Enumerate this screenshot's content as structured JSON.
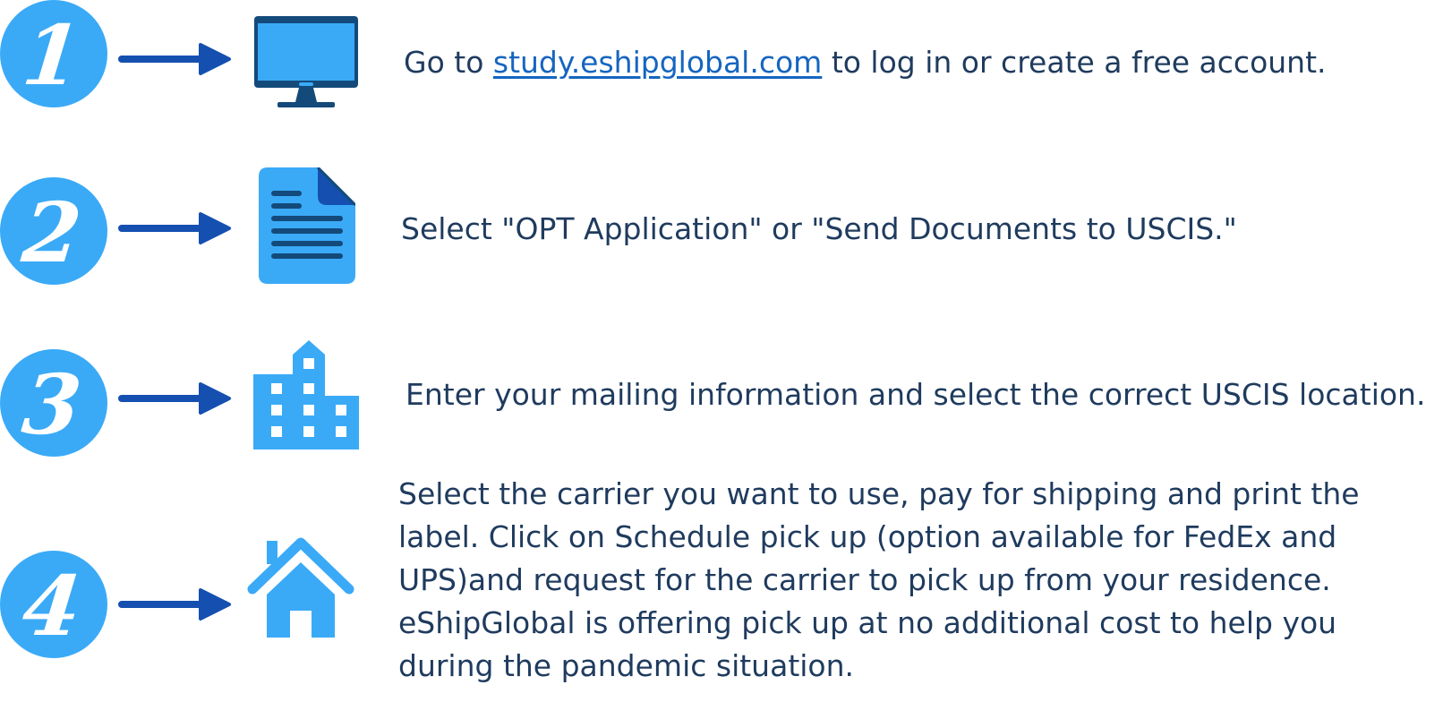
{
  "colors": {
    "circle": "#3aaaf7",
    "arrow": "#1550b0",
    "icon_light": "#3aaaf7",
    "icon_dark": "#134a7a",
    "text": "#1f3b5e",
    "link": "#1565c0"
  },
  "steps": [
    {
      "number": "1",
      "icon": "monitor-icon",
      "text_before": "Go to ",
      "link_text": "study.eshipglobal.com",
      "text_after": " to log in or create a free account."
    },
    {
      "number": "2",
      "icon": "document-icon",
      "text": "Select \"OPT Application\" or \"Send Documents to USCIS.\""
    },
    {
      "number": "3",
      "icon": "building-icon",
      "text": "Enter your mailing information and select the correct USCIS location."
    },
    {
      "number": "4",
      "icon": "house-icon",
      "lines": [
        "Select the carrier you want to use, pay for shipping and print the",
        "label. Click on Schedule pick up (option available for FedEx and",
        "UPS)and request for the carrier to pick up from your residence.",
        "eShipGlobal is offering pick up at no additional cost to help you",
        "during the pandemic situation."
      ]
    }
  ]
}
